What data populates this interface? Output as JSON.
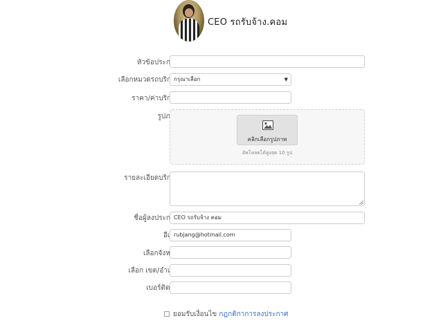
{
  "header": {
    "site_title": "CEO  รถรับจ้าง.คอม"
  },
  "form": {
    "title": {
      "label": "หัวข้อประกาศ",
      "value": ""
    },
    "category": {
      "label": "เลือกหมวดรถบริการ",
      "selected": "กรุณาเลือก"
    },
    "price": {
      "label": "ราคา/ค่าบริการ",
      "value": ""
    },
    "images": {
      "label": "รูปภาพ",
      "button_label": "คลิกเลือกรูปภาพ",
      "hint": "อัพโหลดได้สูงสุด 10 รูป"
    },
    "details": {
      "label": "รายละเอียดบริการ",
      "value": ""
    },
    "poster_name": {
      "label": "ชื่อผู้ลงประกาศ",
      "value": "CEO รถรับจ้าง คอม"
    },
    "email": {
      "label": "อีเมล์",
      "value": "rubjang@hotmail.com"
    },
    "province": {
      "label": "เลือกจังหวัด",
      "value": ""
    },
    "district": {
      "label": "เลือก เขต/อำเภอ",
      "value": ""
    },
    "phone": {
      "label": "เบอร์ติดต่อ",
      "value": ""
    },
    "terms": {
      "prefix": "ยอมรับเงื่อนไข",
      "link_label": "กฎกติกาการลงประกาศ",
      "checked": false
    }
  },
  "colors": {
    "link": "#3a6fc4",
    "border": "#cccccc",
    "label_text": "#555555"
  }
}
